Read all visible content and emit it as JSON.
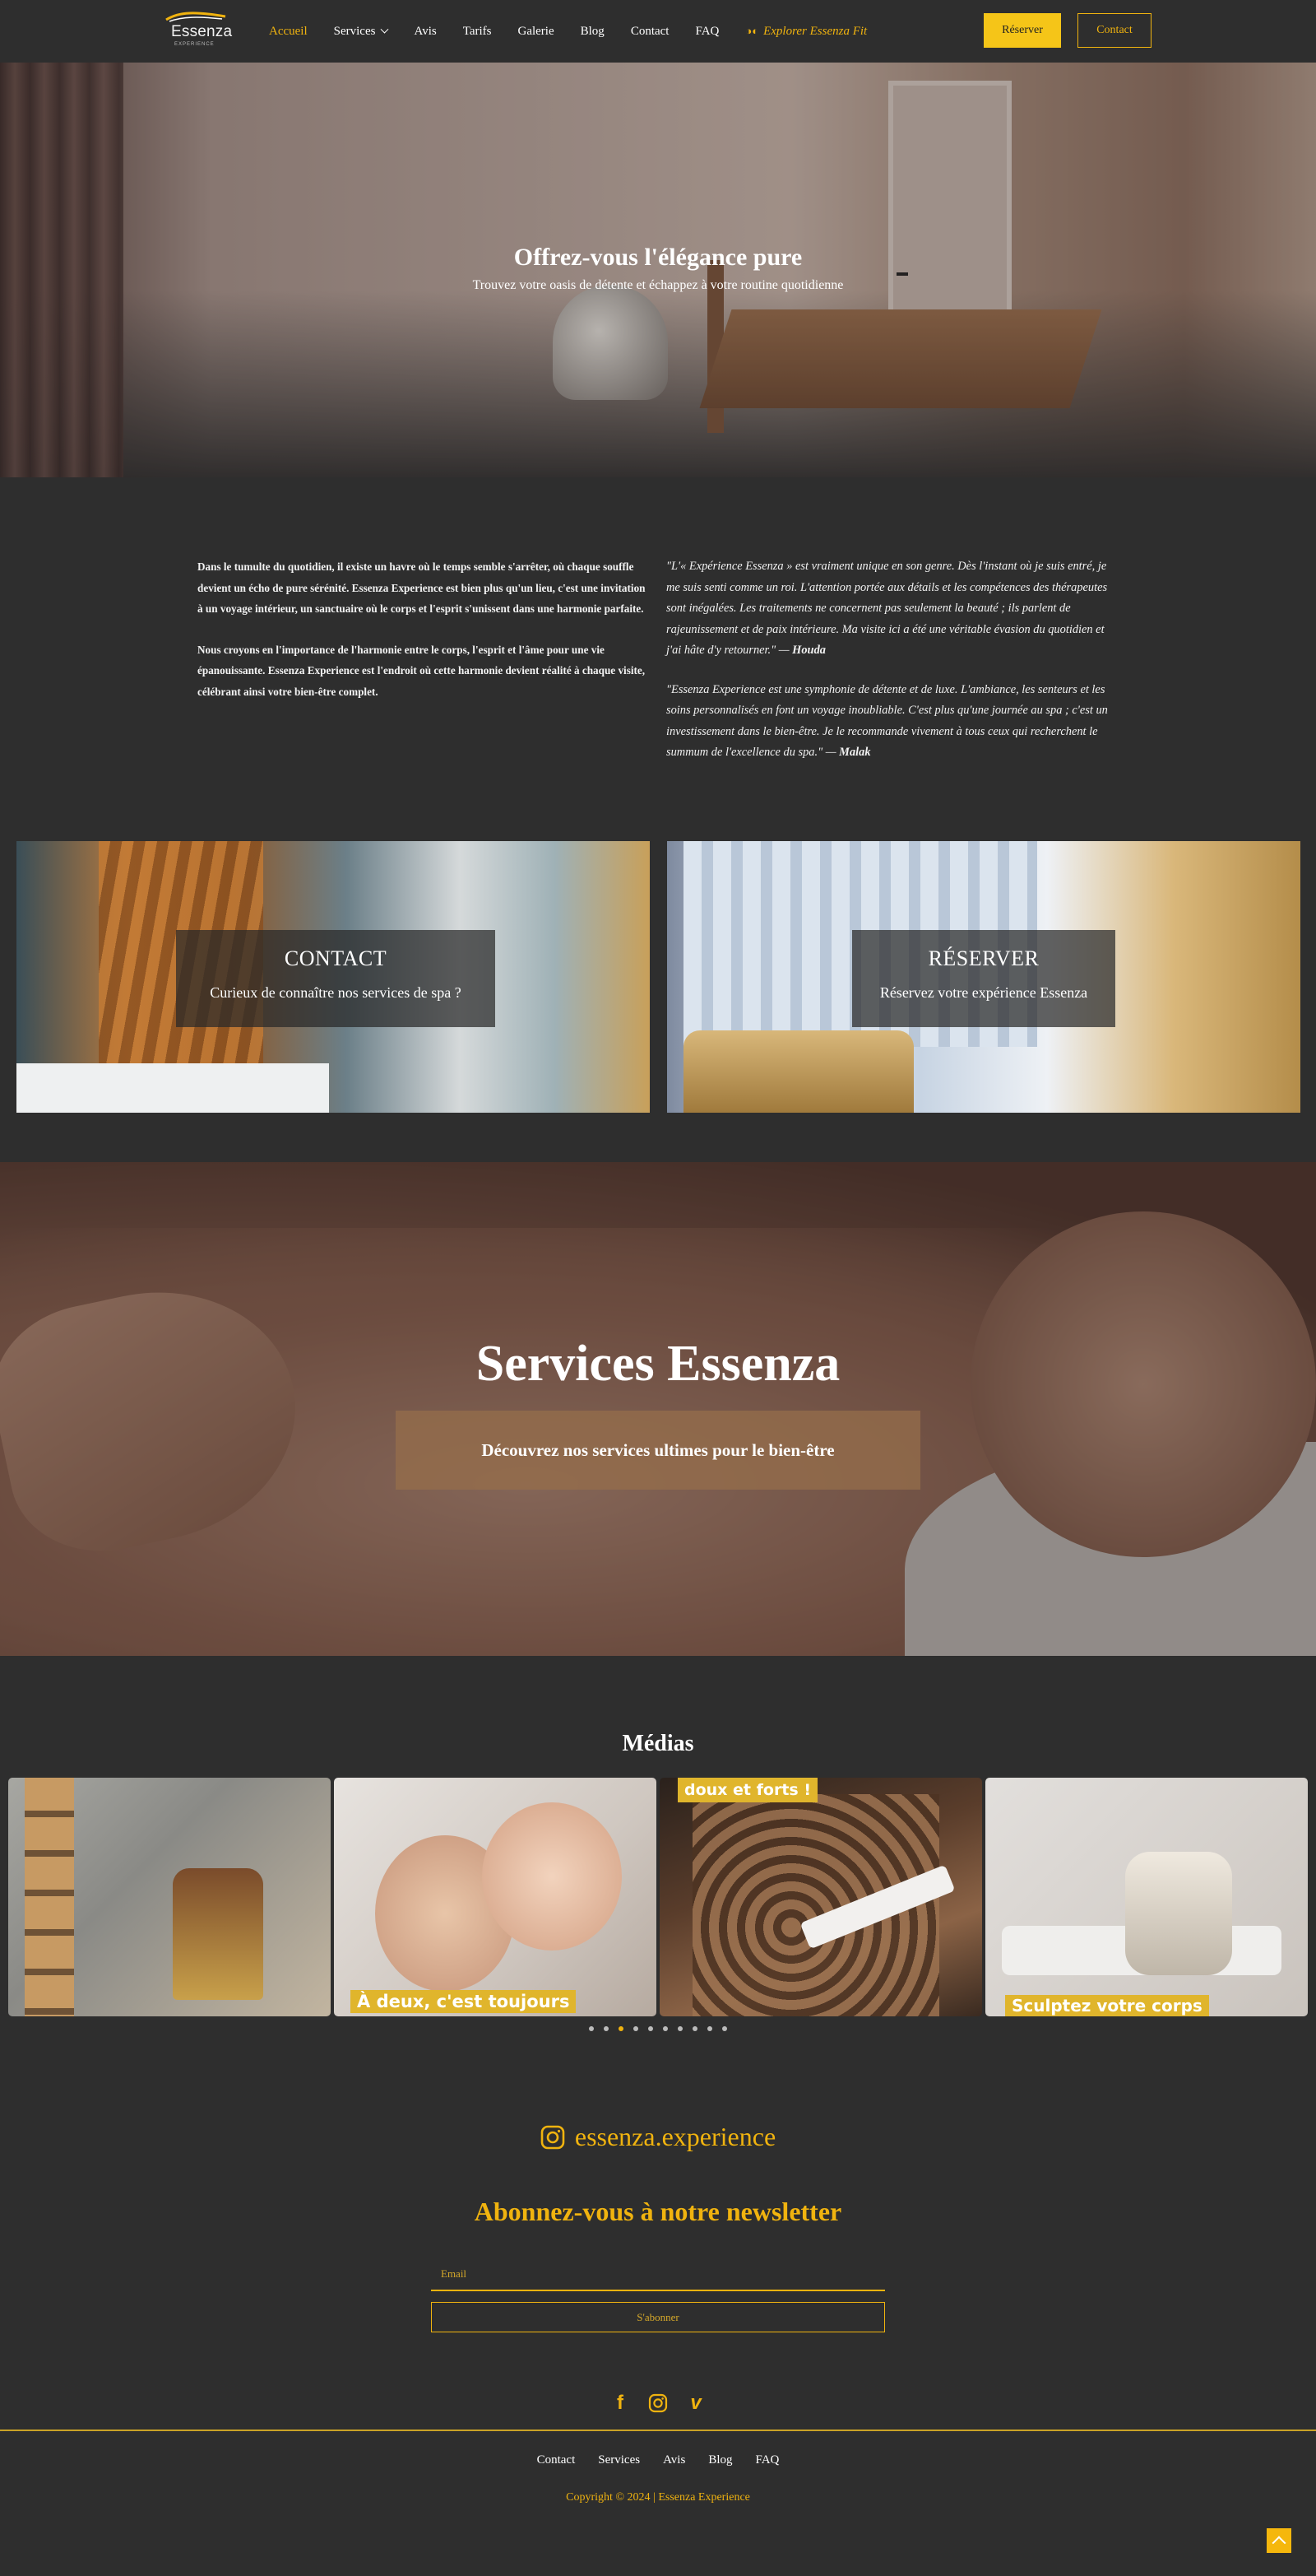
{
  "brand": {
    "logo_text": "Essenza",
    "logo_tagline": "EXPERIENCE",
    "accent_color": "#f0b30f"
  },
  "nav": {
    "items": [
      {
        "label": "Accueil",
        "active": true
      },
      {
        "label": "Services"
      },
      {
        "label": "Avis"
      },
      {
        "label": "Tarifs"
      },
      {
        "label": "Galerie"
      },
      {
        "label": "Blog"
      },
      {
        "label": "Contact"
      },
      {
        "label": "FAQ"
      }
    ],
    "fit_label": "Explorer Essenza Fit",
    "reserve_button": "Réserver",
    "contact_button": "Contact"
  },
  "hero": {
    "title": "Offrez-vous l'élégance pure",
    "subtitle": "Trouvez votre oasis de détente et échappez à votre routine quotidienne"
  },
  "intro": {
    "left": [
      "Dans le tumulte du quotidien, il existe un havre où le temps semble s'arrêter, où chaque souffle devient un écho de pure sérénité. Essenza Experience est bien plus qu'un lieu, c'est une invitation à un voyage intérieur, un sanctuaire où le corps et l'esprit s'unissent dans une harmonie parfaite.",
      "Nous croyons en l'importance de l'harmonie entre le corps, l'esprit et l'âme pour une vie épanouissante. Essenza Experience est l'endroit où cette harmonie devient réalité à chaque visite, célébrant ainsi votre bien-être complet."
    ],
    "testimonials": [
      {
        "quote": "\"L'« Expérience Essenza » est vraiment unique en son genre. Dès l'instant où je suis entré, je me suis senti comme un roi. L'attention portée aux détails et les compétences des thérapeutes sont inégalées. Les traitements ne concernent pas seulement la beauté ; ils parlent de rajeunissement et de paix intérieure. Ma visite ici a été une véritable évasion du quotidien et j'ai hâte d'y retourner.\" —",
        "author": "Houda"
      },
      {
        "quote": "\"Essenza Experience est une symphonie de détente et de luxe. L'ambiance, les senteurs et les soins personnalisés en font un voyage inoubliable. C'est plus qu'une journée au spa ; c'est un investissement dans le bien-être. Je le recommande vivement à tous ceux qui recherchent le summum de l'excellence du spa.\" —",
        "author": "Malak"
      }
    ]
  },
  "cta": {
    "contact": {
      "title": "CONTACT",
      "text": "Curieux de connaître nos services de spa ?"
    },
    "reserve": {
      "title": "RÉSERVER",
      "text": "Réservez votre expérience Essenza"
    }
  },
  "services": {
    "title": "Services Essenza",
    "subtitle": "Découvrez nos services ultimes pour le bien-être"
  },
  "media": {
    "title": "Médias",
    "slides": [
      {
        "caption": ""
      },
      {
        "caption": "À deux, c'est toujours"
      },
      {
        "caption": "doux et forts !"
      },
      {
        "caption": "Sculptez votre corps"
      }
    ],
    "dots_count": 10,
    "active_dot": 2
  },
  "instagram": {
    "handle": "essenza.experience",
    "icon": "instagram-icon"
  },
  "newsletter": {
    "title": "Abonnez-vous à notre newsletter",
    "email_placeholder": "Email",
    "button": "S'abonner"
  },
  "social": {
    "icons": [
      "facebook-icon",
      "instagram-icon",
      "vimeo-icon"
    ]
  },
  "footer": {
    "links": [
      "Contact",
      "Services",
      "Avis",
      "Blog",
      "FAQ"
    ],
    "copyright": "Copyright © 2024 | Essenza Experience"
  }
}
